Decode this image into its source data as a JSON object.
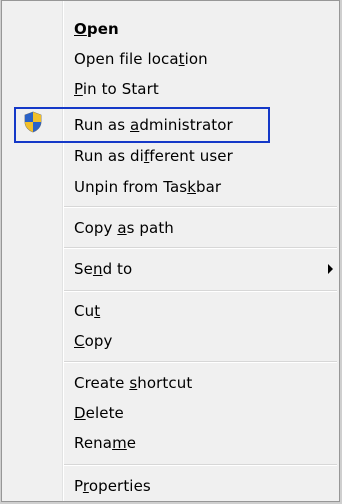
{
  "context_menu": {
    "open": {
      "pre": "",
      "key": "O",
      "post": "pen"
    },
    "open_file_location": {
      "pre": "Open file loca",
      "key": "t",
      "post": "ion"
    },
    "pin_to_start": {
      "pre": "",
      "key": "P",
      "post": "in to Start"
    },
    "run_as_admin": {
      "pre": "Run as ",
      "key": "a",
      "post": "dministrator"
    },
    "run_as_different_user": {
      "pre": "Run as di",
      "key": "f",
      "post": "ferent user"
    },
    "unpin_from_taskbar": {
      "pre": "Unpin from Tas",
      "key": "k",
      "post": "bar"
    },
    "copy_as_path": {
      "pre": "Copy ",
      "key": "a",
      "post": "s path"
    },
    "send_to": {
      "pre": "Se",
      "key": "n",
      "post": "d to"
    },
    "cut": {
      "pre": "Cu",
      "key": "t",
      "post": ""
    },
    "copy": {
      "pre": "",
      "key": "C",
      "post": "opy"
    },
    "create_shortcut": {
      "pre": "Create ",
      "key": "s",
      "post": "hortcut"
    },
    "delete": {
      "pre": "",
      "key": "D",
      "post": "elete"
    },
    "rename": {
      "pre": "Rena",
      "key": "m",
      "post": "e"
    },
    "properties": {
      "pre": "P",
      "key": "r",
      "post": "operties"
    }
  },
  "icons": {
    "run_as_admin": "uac-shield-icon",
    "send_to_submenu": "submenu-arrow-icon"
  },
  "colors": {
    "highlight_border": "#1438c8",
    "menu_background": "#f0f0f0"
  }
}
